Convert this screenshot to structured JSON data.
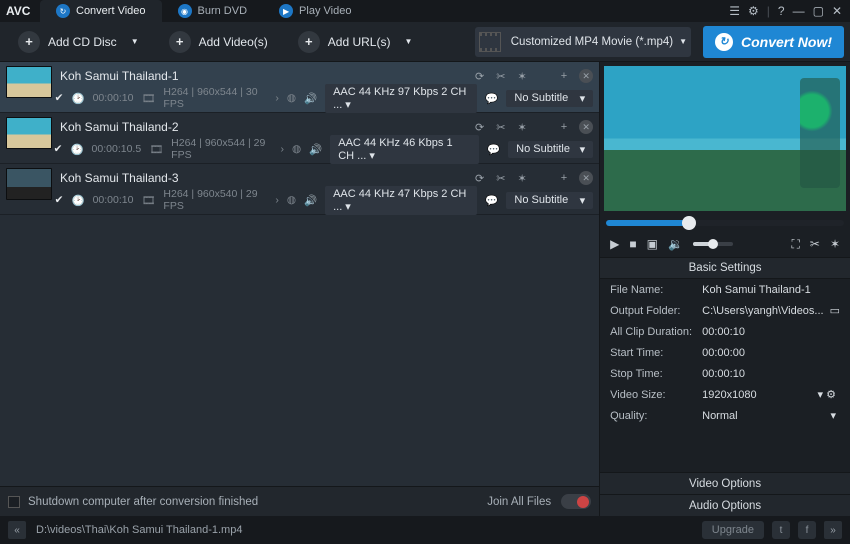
{
  "appbar": {
    "logo": "AVC",
    "tabs": [
      {
        "label": "Convert Video",
        "icon": "refresh"
      },
      {
        "label": "Burn DVD",
        "icon": "disc"
      },
      {
        "label": "Play Video",
        "icon": "play"
      }
    ]
  },
  "toolbar": {
    "add_cd": "Add CD Disc",
    "add_videos": "Add Video(s)",
    "add_urls": "Add URL(s)",
    "format_label": "Customized MP4 Movie (*.mp4)",
    "convert_label": "Convert Now!"
  },
  "items": [
    {
      "title": "Koh Samui Thailand-1",
      "duration": "00:00:10",
      "codec": "H264",
      "resfps": "960x544 | 30 FPS",
      "audio": "AAC 44 KHz 97 Kbps 2 CH ...",
      "subtitle": "No Subtitle",
      "checked": true,
      "active": true,
      "thumb": "light"
    },
    {
      "title": "Koh Samui Thailand-2",
      "duration": "00:00:10.5",
      "codec": "H264",
      "resfps": "960x544 | 29 FPS",
      "audio": "AAC 44 KHz 46 Kbps 1 CH ...",
      "subtitle": "No Subtitle",
      "checked": true,
      "active": false,
      "thumb": "light"
    },
    {
      "title": "Koh Samui Thailand-3",
      "duration": "00:00:10",
      "codec": "H264",
      "resfps": "960x540 | 29 FPS",
      "audio": "AAC 44 KHz 47 Kbps 2 CH ...",
      "subtitle": "No Subtitle",
      "checked": true,
      "active": false,
      "thumb": "dark"
    }
  ],
  "footer": {
    "shutdown_label": "Shutdown computer after conversion finished",
    "join_label": "Join All Files"
  },
  "preview": {
    "basic_settings_header": "Basic Settings",
    "rows": {
      "file_name_label": "File Name:",
      "file_name_value": "Koh Samui Thailand-1",
      "output_folder_label": "Output Folder:",
      "output_folder_value": "C:\\Users\\yangh\\Videos...",
      "all_clip_label": "All Clip Duration:",
      "all_clip_value": "00:00:10",
      "start_time_label": "Start Time:",
      "start_time_value": "00:00:00",
      "stop_time_label": "Stop Time:",
      "stop_time_value": "00:00:10",
      "video_size_label": "Video Size:",
      "video_size_value": "1920x1080",
      "quality_label": "Quality:",
      "quality_value": "Normal"
    },
    "video_options": "Video Options",
    "audio_options": "Audio Options"
  },
  "statusbar": {
    "path": "D:\\videos\\Thai\\Koh Samui Thailand-1.mp4",
    "upgrade": "Upgrade"
  }
}
